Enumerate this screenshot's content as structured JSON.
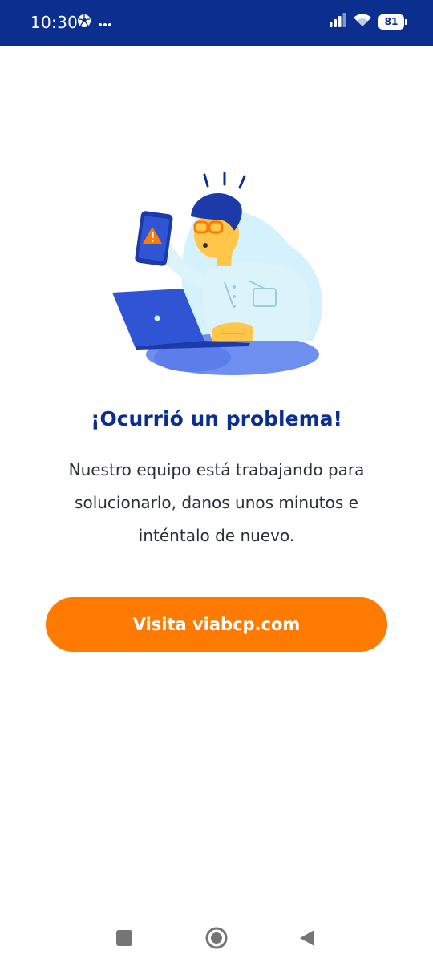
{
  "status_bar": {
    "time": "10:30",
    "battery_level": "81",
    "icons": [
      "soccer-ball-icon",
      "more-dots-icon",
      "signal-icon",
      "wifi-icon",
      "battery-icon"
    ],
    "background_color": "#0a2f8f"
  },
  "error": {
    "illustration": "man-with-phone-warning-illustration",
    "title": "¡Ocurrió un problema!",
    "message": "Nuestro equipo está trabajando para solucionarlo, danos unos minutos e inténtalo de nuevo."
  },
  "actions": {
    "visit_label": "Visita viabcp.com",
    "accent_color": "#ff7a00"
  },
  "nav_bar": {
    "icons": [
      "recents-square-icon",
      "home-circle-icon",
      "back-triangle-icon"
    ]
  }
}
